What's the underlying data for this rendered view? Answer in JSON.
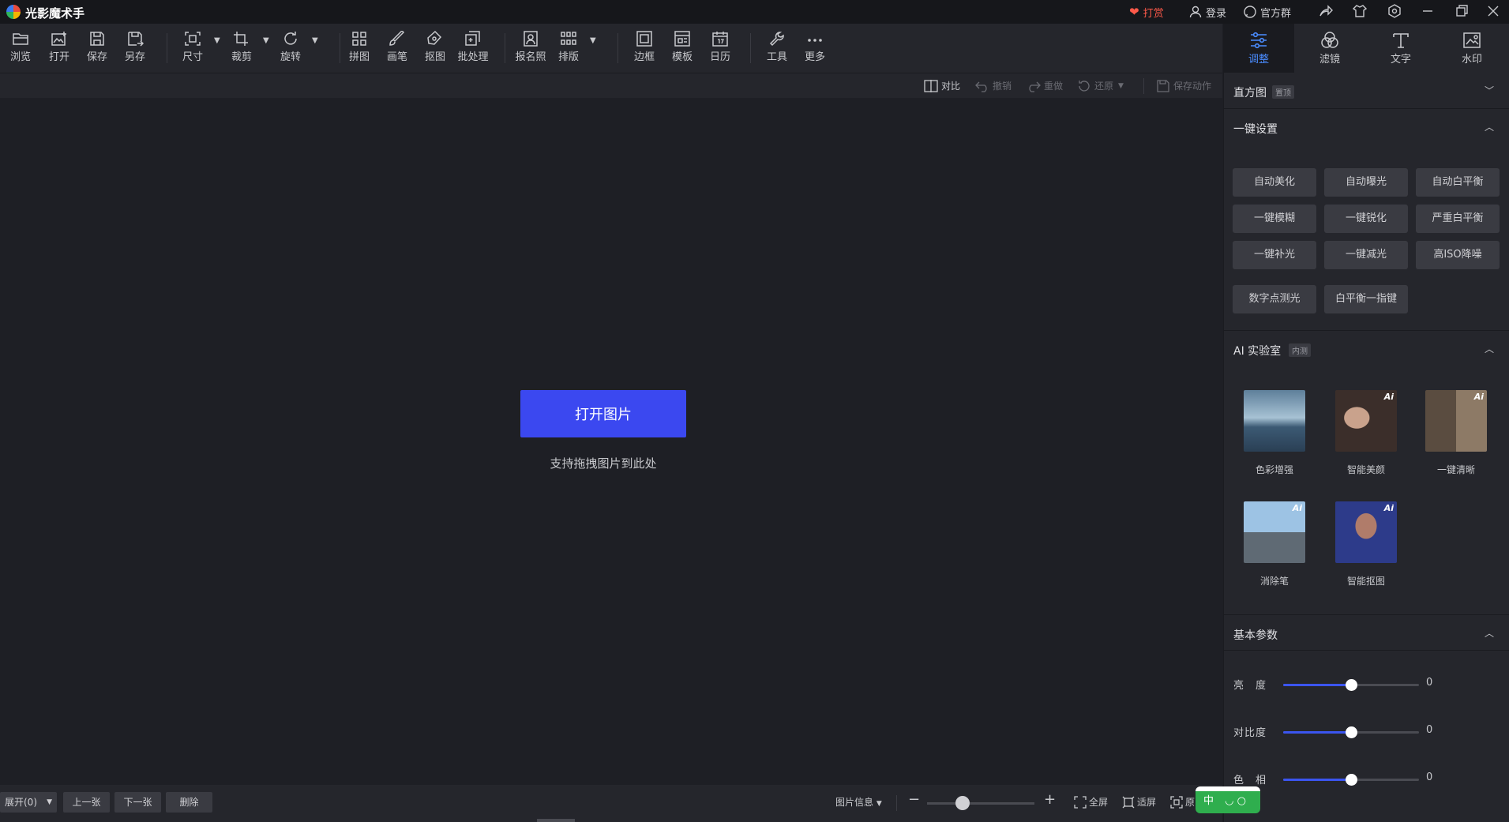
{
  "app": {
    "title": "光影魔术手"
  },
  "titlebar": {
    "tip": "打赏",
    "login": "登录",
    "group": "官方群"
  },
  "toolbar": {
    "browse": "浏览",
    "open": "打开",
    "save": "保存",
    "save_as": "另存",
    "size": "尺寸",
    "crop": "裁剪",
    "rotate": "旋转",
    "collage": "拼图",
    "brush": "画笔",
    "cutout": "抠图",
    "batch": "批处理",
    "id_photo": "报名照",
    "layout": "排版",
    "border": "边框",
    "template": "模板",
    "calendar": "日历",
    "tools": "工具",
    "more": "更多"
  },
  "right_tabs": [
    {
      "label": "调整",
      "active": true
    },
    {
      "label": "滤镜",
      "active": false
    },
    {
      "label": "文字",
      "active": false
    },
    {
      "label": "水印",
      "active": false
    }
  ],
  "actions": {
    "compare": "对比",
    "undo": "撤销",
    "redo": "重做",
    "restore": "还原",
    "save_action": "保存动作"
  },
  "canvas": {
    "open_button": "打开图片",
    "hint": "支持拖拽图片到此处"
  },
  "panel": {
    "histogram": {
      "title": "直方图",
      "badge": "置顶"
    },
    "quick": {
      "title": "一键设置",
      "buttons": [
        "自动美化",
        "自动曝光",
        "自动白平衡",
        "一键模糊",
        "一键锐化",
        "严重白平衡",
        "一键补光",
        "一键减光",
        "高ISO降噪",
        "数字点测光",
        "白平衡一指键"
      ]
    },
    "ai": {
      "title": "AI 实验室",
      "badge": "内测",
      "badge_ai": "Ai",
      "items": [
        "色彩增强",
        "智能美颜",
        "一键清晰",
        "消除笔",
        "智能抠图"
      ]
    },
    "basic": {
      "title": "基本参数",
      "params": [
        {
          "label": "亮　度",
          "value": "0",
          "level": 0.5
        },
        {
          "label": "对比度",
          "value": "0",
          "level": 0.5
        },
        {
          "label": "色　相",
          "value": "0",
          "level": 0.5
        }
      ]
    }
  },
  "bottombar": {
    "expand": "展开(0)",
    "prev": "上一张",
    "next": "下一张",
    "delete": "删除",
    "info": "图片信息",
    "fullscreen": "全屏",
    "fit": "适屏",
    "actual": "原"
  },
  "ime": {
    "label": "中"
  }
}
